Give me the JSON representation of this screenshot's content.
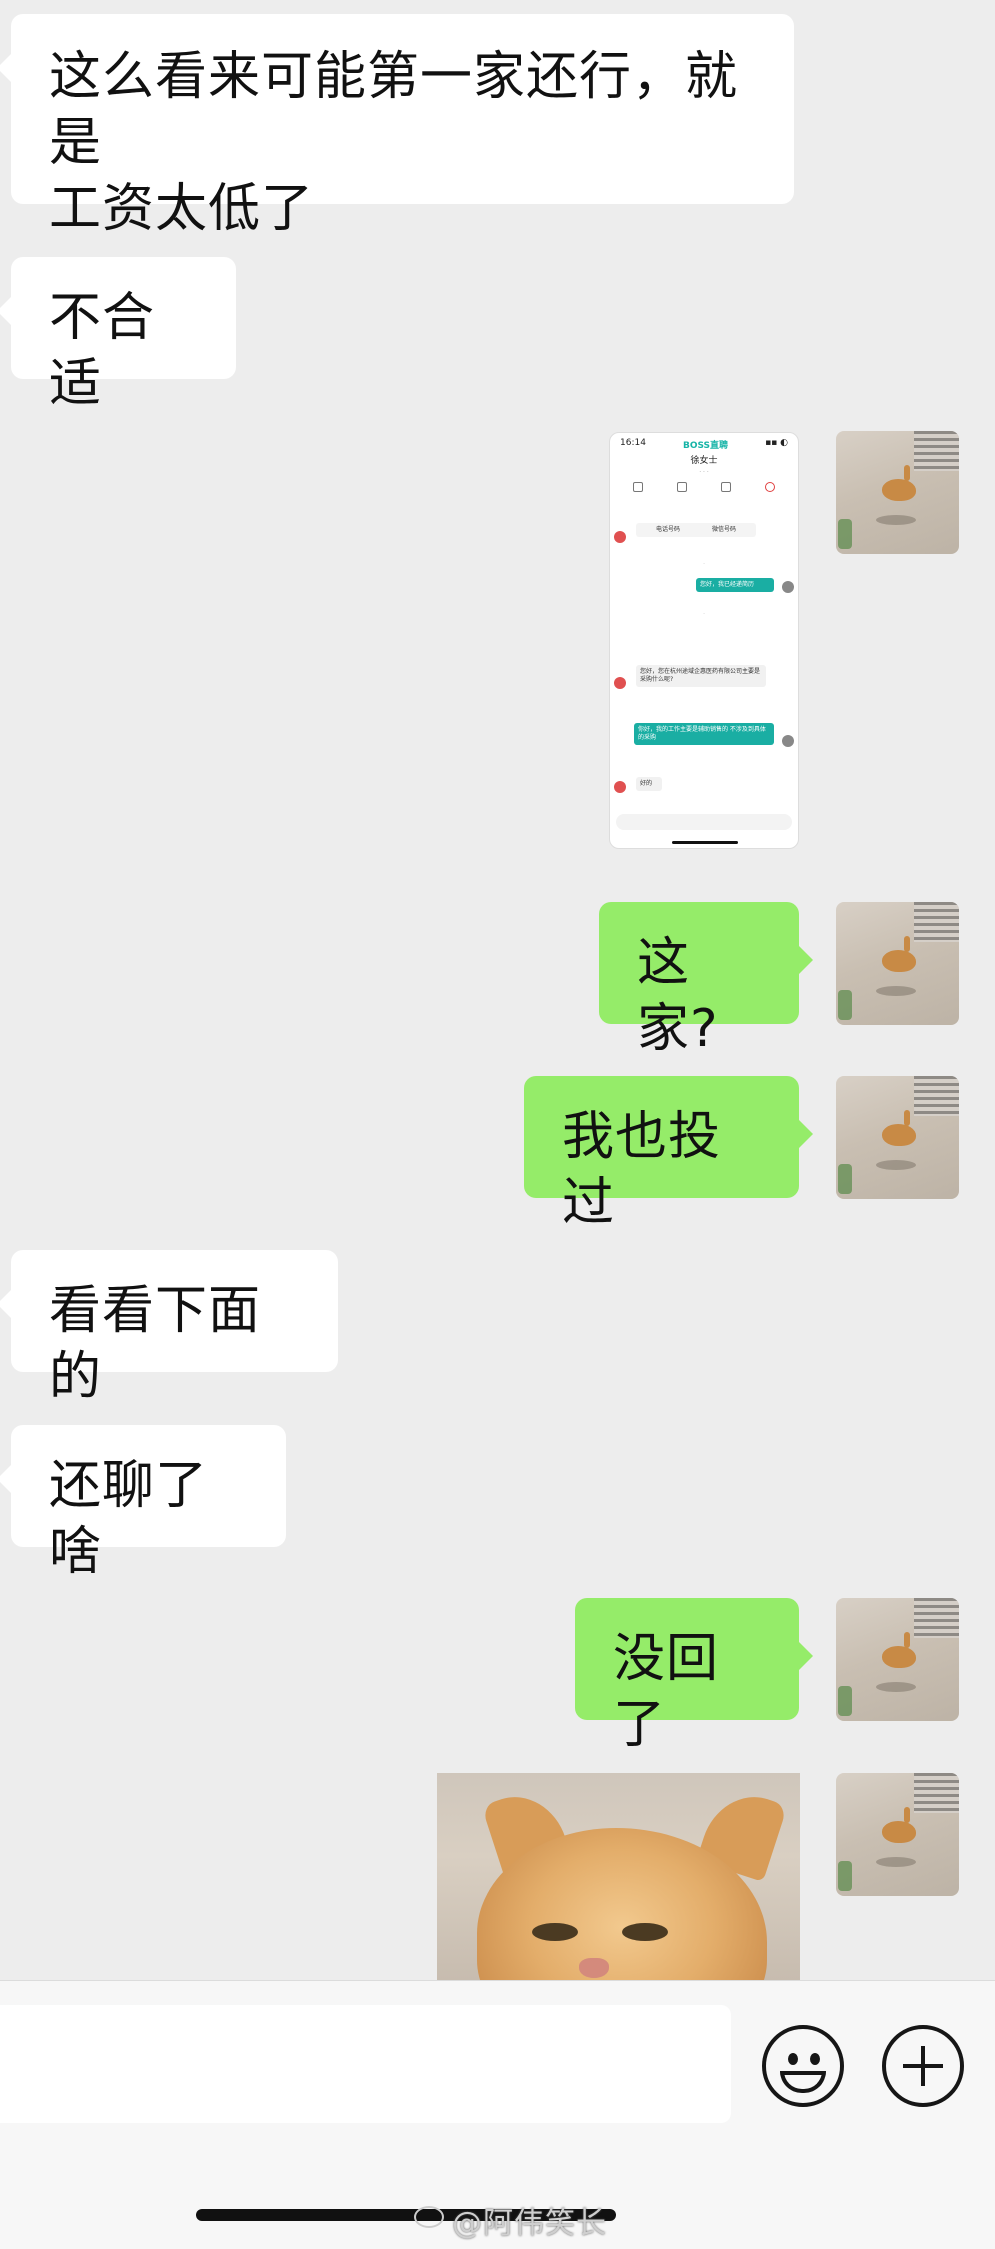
{
  "messages": {
    "m1_line1": "这么看来可能第一家还行，就是",
    "m1_line2": "工资太低了",
    "m2": "不合适",
    "m4": "这家?",
    "m5": "我也投过",
    "m6": "看看下面的",
    "m7": "还聊了啥",
    "m8": "没回了"
  },
  "embedded_screenshot": {
    "time": "16:14",
    "app": "BOSS直聘",
    "contact": "徐女士",
    "phone_label": "电话号码",
    "wechat_label": "微信号码",
    "out_1": "您好，我已经递简历",
    "in_1": "您好，您在杭州途域企惠医药有限公司主要是采购什么呢?",
    "out_2": "你好，我的工作主要是辅助销售的 不涉及到具体的采购",
    "in_2": "好的"
  },
  "icons": {
    "emoji": "emoji-smile-icon",
    "plus": "plus-circle-icon"
  },
  "watermark": "@阿伟笑长"
}
